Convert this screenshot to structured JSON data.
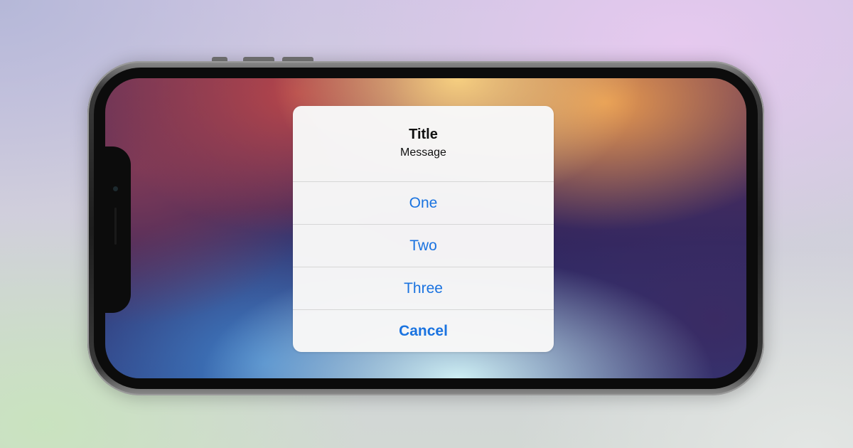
{
  "alert": {
    "title": "Title",
    "message": "Message",
    "actions": [
      {
        "label": "One"
      },
      {
        "label": "Two"
      },
      {
        "label": "Three"
      }
    ],
    "cancel_label": "Cancel"
  },
  "colors": {
    "action_blue": "#1a73e0",
    "alert_background": "#f7f7f7",
    "separator": "#d6d6d6",
    "phone_frame": "#1d1d1d"
  }
}
